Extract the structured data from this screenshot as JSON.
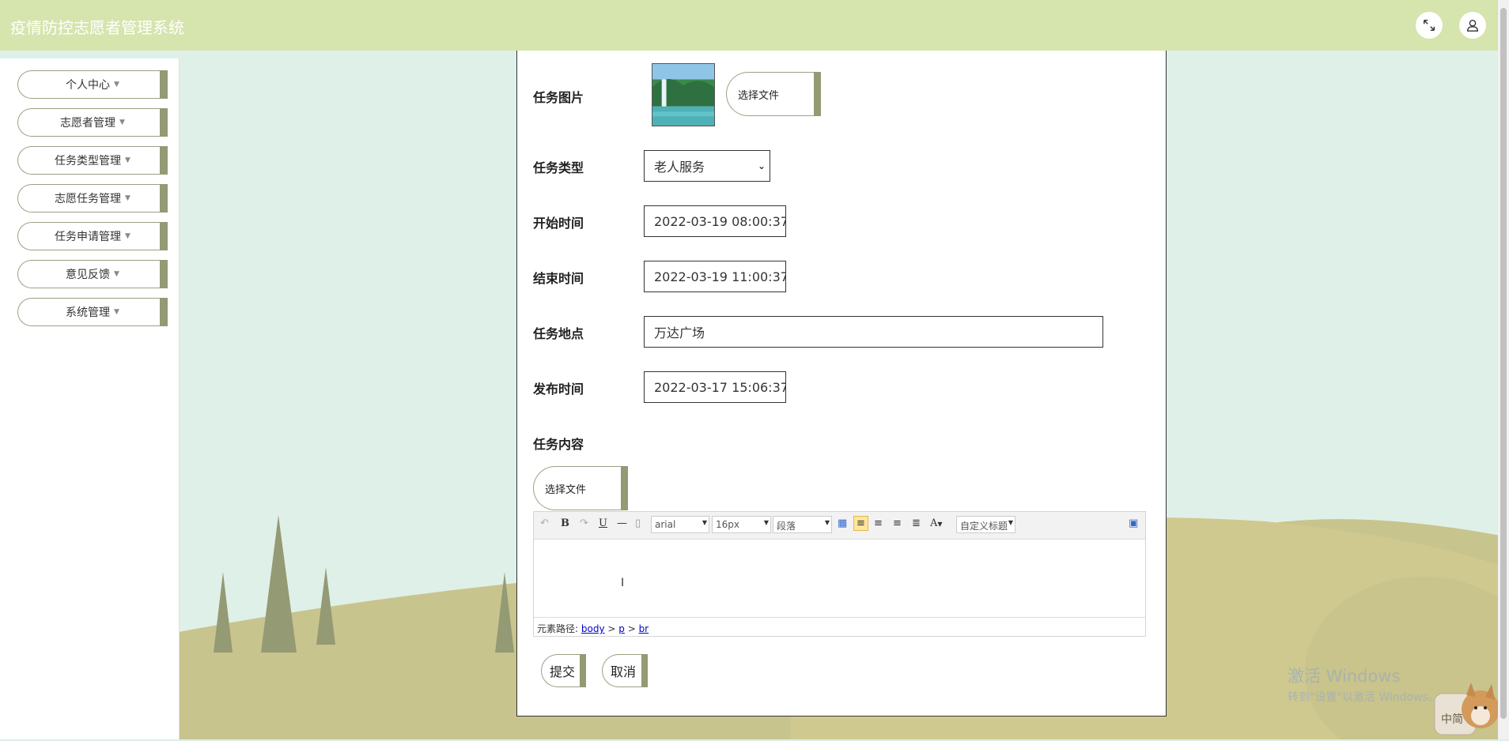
{
  "header": {
    "title": "疫情防控志愿者管理系统"
  },
  "sidebar": {
    "items": [
      {
        "label": "个人中心"
      },
      {
        "label": "志愿者管理"
      },
      {
        "label": "任务类型管理"
      },
      {
        "label": "志愿任务管理"
      },
      {
        "label": "任务申请管理"
      },
      {
        "label": "意见反馈"
      },
      {
        "label": "系统管理"
      }
    ]
  },
  "form": {
    "image_label": "任务图片",
    "choose_file_label": "选择文件",
    "type_label": "任务类型",
    "type_value": "老人服务",
    "start_label": "开始时间",
    "start_value": "2022-03-19 08:00:37",
    "end_label": "结束时间",
    "end_value": "2022-03-19 11:00:37",
    "location_label": "任务地点",
    "location_value": "万达广场",
    "publish_label": "发布时间",
    "publish_value": "2022-03-17 15:06:37",
    "content_label": "任务内容",
    "content_choose_file_label": "选择文件",
    "submit_label": "提交",
    "cancel_label": "取消"
  },
  "editor": {
    "font_family": "arial",
    "font_size": "16px",
    "paragraph": "段落",
    "custom_title": "自定义标题",
    "path_label": "元素路径:",
    "path": [
      "body",
      "p",
      "br"
    ]
  },
  "watermark": {
    "line1": "激活 Windows",
    "line2": "转到\"设置\"以激活 Windows。"
  },
  "mascot": {
    "text": "中简"
  }
}
